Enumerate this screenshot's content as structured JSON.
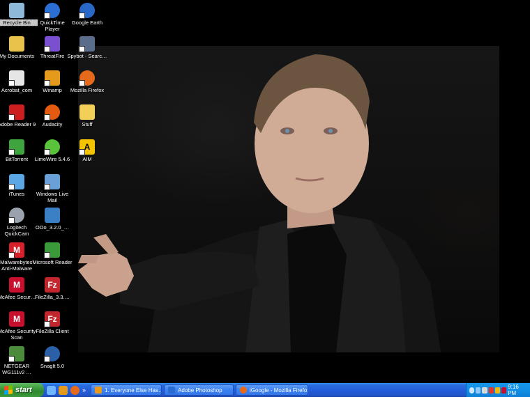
{
  "desktop": {
    "icons": [
      {
        "label": "Recycle Bin",
        "icon": "recycle-bin-icon",
        "color": "#8fb9d8"
      },
      {
        "label": "My Documents",
        "icon": "documents-folder-icon",
        "color": "#e8c24a"
      },
      {
        "label": "Acrobat_com",
        "icon": "acrobat-com-icon",
        "color": "#e6e6e6"
      },
      {
        "label": "Adobe Reader 9",
        "icon": "adobe-reader-icon",
        "color": "#cc1e1e"
      },
      {
        "label": "BitTorrent",
        "icon": "bittorrent-icon",
        "color": "#3ea53e"
      },
      {
        "label": "iTunes",
        "icon": "itunes-icon",
        "color": "#5ba7e6"
      },
      {
        "label": "Logitech QuickCam",
        "icon": "webcam-icon",
        "color": "#9aa3ad"
      },
      {
        "label": "Malwarebytes' Anti-Malware",
        "icon": "malwarebytes-icon",
        "color": "#d6202a"
      },
      {
        "label": "McAfee Secur…",
        "icon": "mcafee-icon",
        "color": "#c8102e"
      },
      {
        "label": "McAfee Security Scan",
        "icon": "mcafee-scan-icon",
        "color": "#c8102e"
      },
      {
        "label": "NETGEAR WG111v2 …",
        "icon": "netgear-wireless-icon",
        "color": "#4a8c3a"
      },
      {
        "label": "QuickTime Player",
        "icon": "quicktime-icon",
        "color": "#2b6fd6"
      },
      {
        "label": "ThreatFire",
        "icon": "threatfire-icon",
        "color": "#7a4fd0"
      },
      {
        "label": "Winamp",
        "icon": "winamp-icon",
        "color": "#e59a1c"
      },
      {
        "label": "Audacity",
        "icon": "audacity-icon",
        "color": "#e35a10"
      },
      {
        "label": "LimeWire 5.4.6",
        "icon": "limewire-icon",
        "color": "#5ac33c"
      },
      {
        "label": "Windows Live Mail",
        "icon": "live-mail-icon",
        "color": "#6aa0d8"
      },
      {
        "label": "OOo_3.2.0_…",
        "icon": "openoffice-installer-icon",
        "color": "#3b7fc4"
      },
      {
        "label": "Microsoft Reader",
        "icon": "microsoft-reader-icon",
        "color": "#3a9a3a"
      },
      {
        "label": "FileZilla_3.3.…",
        "icon": "filezilla-installer-icon",
        "color": "#c1272d"
      },
      {
        "label": "FileZilla Client",
        "icon": "filezilla-icon",
        "color": "#c1272d"
      },
      {
        "label": "SnagIt 5.0",
        "icon": "snagit-icon",
        "color": "#2b5fa8"
      },
      {
        "label": "Google Earth",
        "icon": "google-earth-icon",
        "color": "#2a68c7"
      },
      {
        "label": "Spybot - Searc…",
        "icon": "spybot-icon",
        "color": "#5a6e8c"
      },
      {
        "label": "Mozilla Firefox",
        "icon": "firefox-icon",
        "color": "#e66a1b"
      },
      {
        "label": "Stuff",
        "icon": "folder-icon",
        "color": "#f2cf58"
      },
      {
        "label": "AIM",
        "icon": "aim-icon",
        "color": "#f5c400"
      }
    ]
  },
  "taskbar": {
    "start_label": "start",
    "quick_launch": [
      {
        "icon": "show-desktop-icon",
        "color": "#6fb6ff"
      },
      {
        "icon": "winamp-icon",
        "color": "#e59a1c"
      },
      {
        "icon": "firefox-icon",
        "color": "#e66a1b"
      }
    ],
    "chevron": "»",
    "tasks": [
      {
        "label": "1. Everyone Else Has…",
        "icon": "winamp-icon",
        "color": "#e59a1c"
      },
      {
        "label": "Adobe Photoshop",
        "icon": "photoshop-icon",
        "color": "#2a6bd1"
      },
      {
        "label": "iGoogle - Mozilla Firefox",
        "icon": "firefox-icon",
        "color": "#e66a1b"
      }
    ],
    "tray_icons": [
      {
        "icon": "expand-tray-icon",
        "color": "#cfe6ff"
      },
      {
        "icon": "network-icon",
        "color": "#8fc7ff"
      },
      {
        "icon": "volume-icon",
        "color": "#d8d8d8"
      },
      {
        "icon": "security-icon",
        "color": "#e4352b"
      },
      {
        "icon": "updates-icon",
        "color": "#f2b705"
      },
      {
        "icon": "mcafee-tray-icon",
        "color": "#c8102e"
      },
      {
        "icon": "messenger-tray-icon",
        "color": "#5ac33c"
      }
    ],
    "clock": "9:16 PM"
  }
}
